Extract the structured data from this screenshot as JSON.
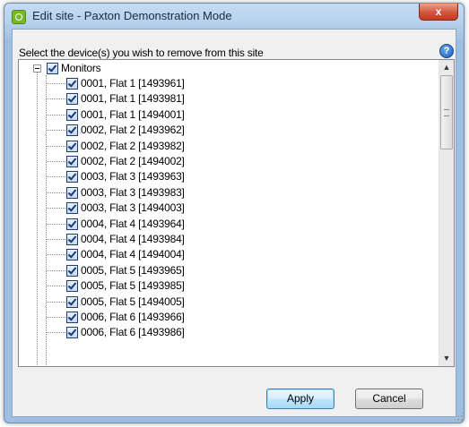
{
  "window": {
    "title": "Edit site - Paxton Demonstration Mode",
    "close_glyph": "x"
  },
  "instruction": "Select the device(s) you wish to remove from this site",
  "help_glyph": "?",
  "tree": {
    "root": {
      "label": "Monitors",
      "checked": true,
      "expanded": true
    },
    "items": [
      {
        "label": "0001, Flat 1 [1493961]",
        "checked": true
      },
      {
        "label": "0001, Flat 1 [1493981]",
        "checked": true
      },
      {
        "label": "0001, Flat 1 [1494001]",
        "checked": true
      },
      {
        "label": "0002, Flat 2 [1493962]",
        "checked": true
      },
      {
        "label": "0002, Flat 2 [1493982]",
        "checked": true
      },
      {
        "label": "0002, Flat 2 [1494002]",
        "checked": true
      },
      {
        "label": "0003, Flat 3 [1493963]",
        "checked": true
      },
      {
        "label": "0003, Flat 3 [1493983]",
        "checked": true
      },
      {
        "label": "0003, Flat 3 [1494003]",
        "checked": true
      },
      {
        "label": "0004, Flat 4 [1493964]",
        "checked": true
      },
      {
        "label": "0004, Flat 4 [1493984]",
        "checked": true
      },
      {
        "label": "0004, Flat 4 [1494004]",
        "checked": true
      },
      {
        "label": "0005, Flat 5 [1493965]",
        "checked": true
      },
      {
        "label": "0005, Flat 5 [1493985]",
        "checked": true
      },
      {
        "label": "0005, Flat 5 [1494005]",
        "checked": true
      },
      {
        "label": "0006, Flat 6 [1493966]",
        "checked": true
      },
      {
        "label": "0006, Flat 6 [1493986]",
        "checked": true
      }
    ]
  },
  "scrollbar": {
    "up_glyph": "▲",
    "down_glyph": "▼"
  },
  "buttons": {
    "apply": "Apply",
    "cancel": "Cancel"
  },
  "icons": {
    "app": "paxton-app-icon",
    "close": "close-icon",
    "help": "help-icon",
    "grip": "resize-grip-icon"
  }
}
